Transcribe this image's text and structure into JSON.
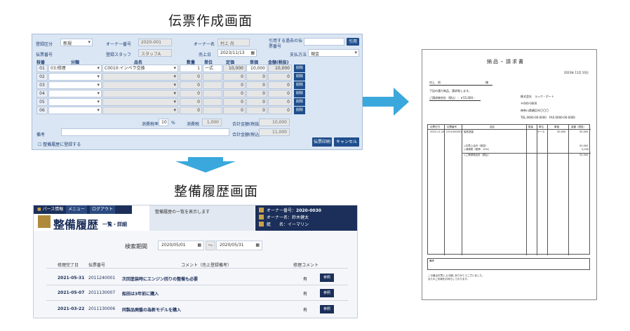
{
  "captions": {
    "slip": "伝票作成画面",
    "history": "整備履歴画面"
  },
  "slip": {
    "labels": {
      "register_type": "登録区分",
      "slip_no": "伝票番号",
      "owner_no": "オーナー番号",
      "staff": "登録スタッフ",
      "owner_name": "オーナー名",
      "sales_date": "売上日",
      "copy_slip_line1": "引用する過去の伝",
      "copy_slip_line2": "票番号",
      "payment": "支払方法",
      "tax_rate": "消費税率",
      "tax_unit": "%",
      "tax": "消費税",
      "subtotal": "合計金額(税抜)",
      "total": "合計金額(税込)",
      "note": "備考",
      "register_history": "整備履歴に登録する"
    },
    "values": {
      "register_type": "新規",
      "owner_no": "2020-001",
      "staff": "スタッフA",
      "owner_name": "村上 尚",
      "sales_date": "2023/11/13",
      "payment": "現金",
      "tax_rate": "10",
      "tax": "1,000",
      "subtotal": "10,000",
      "total": "11,000"
    },
    "buttons": {
      "copy": "引用",
      "delete": "削除",
      "print": "伝票印刷",
      "cancel": "キャンセル"
    },
    "columns": [
      "枝番",
      "分類",
      "品名",
      "数量",
      "単位",
      "定価",
      "単価",
      "金額(税抜)"
    ],
    "rows": [
      {
        "no": "01",
        "category": "03:修理",
        "item": "C0010:インペラ交換",
        "qty": "1",
        "unit": "一式",
        "list": "10,000",
        "price": "10,000",
        "amount": "10,000"
      },
      {
        "no": "02",
        "category": "",
        "item": "",
        "qty": "0",
        "unit": "",
        "list": "0",
        "price": "0",
        "amount": "0"
      },
      {
        "no": "03",
        "category": "",
        "item": "",
        "qty": "0",
        "unit": "",
        "list": "0",
        "price": "0",
        "amount": "0"
      },
      {
        "no": "04",
        "category": "",
        "item": "",
        "qty": "0",
        "unit": "",
        "list": "0",
        "price": "0",
        "amount": "0"
      },
      {
        "no": "05",
        "category": "",
        "item": "",
        "qty": "0",
        "unit": "",
        "list": "0",
        "price": "0",
        "amount": "0"
      },
      {
        "no": "06",
        "category": "",
        "item": "",
        "qty": "0",
        "unit": "",
        "list": "0",
        "price": "0",
        "amount": "0"
      }
    ]
  },
  "history": {
    "nav": [
      "パース情報",
      "メニュー",
      "ログアウト"
    ],
    "title": "整備履歴",
    "subtitle": "一覧・詳細",
    "message": "整備履歴の一覧を表示します",
    "info": [
      {
        "label": "オーナー番号",
        "value": "2020-0030"
      },
      {
        "label": "オーナー名",
        "value": "鈴木健太"
      },
      {
        "label": "艇　　名",
        "value": "イーマリン"
      }
    ],
    "search_label": "検索期間",
    "date_from": "2020/05/01",
    "date_to": "2020/05/31",
    "date_sep": "～",
    "columns": [
      "修理完了日",
      "伝票番号",
      "コメント（売上登録備考）",
      "修理コメント"
    ],
    "rows": [
      {
        "date": "2021-05-31",
        "slip": "2011240001",
        "comment": "次回塗装時にエンジン回りの整備も必要",
        "repair": "有",
        "button": "参照"
      },
      {
        "date": "2021-05-07",
        "slip": "2011130007",
        "comment": "船田は3年前に購入",
        "repair": "有",
        "button": "参照"
      },
      {
        "date": "2021-03-22",
        "slip": "2011130006",
        "comment": "同製品廃盤の為新モデルを購入",
        "repair": "有",
        "button": "参照"
      }
    ]
  },
  "invoice": {
    "title": "納品・請求書",
    "date": "2023年 11月 10日",
    "customer": "村上　尚",
    "honorific": "様",
    "message": "下記の通り納品、請求致します。",
    "total_label": "ご請求総合計（税込）：￥55,000.-",
    "company": "株式会社　ラック・ボート",
    "zip": "〒000-0000",
    "address": "神奈川県横浜市〇〇〇",
    "phone": "TEL.0000-00-0000　FAX.0000-00-0000",
    "columns": [
      "伝票日付",
      "伝票番号",
      "品名",
      "数量",
      "単位",
      "単価",
      "金額（税抜）"
    ],
    "row": {
      "date": "2023-11-10",
      "slip": "2311000001",
      "item": "船底塗装",
      "unit": "ケース",
      "price": "50,000",
      "amount": "50,000"
    },
    "summary": [
      {
        "label": "◇お買上合計（税抜）",
        "value": "50,000"
      },
      {
        "label": "◇消費税（税率：10%）",
        "value": "5,000"
      },
      {
        "label": "◇ご請求総合計（税込）",
        "value": "55,000"
      }
    ],
    "note_label": "備考",
    "footer1": "この度はお買い上げ誠にありがとうございました。",
    "footer2": "またのご利用をお待ちしております。"
  },
  "colors": {
    "panel_blue": "#dbe6f4",
    "navy": "#1b2f5a",
    "button_blue": "#1f4e8c",
    "arrow_blue": "#3aa8dc"
  }
}
